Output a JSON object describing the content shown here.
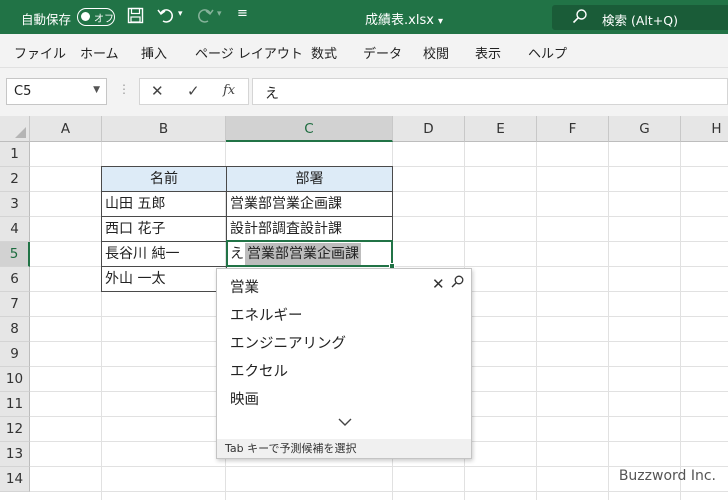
{
  "titlebar": {
    "autosave_label": "自動保存",
    "autosave_toggle": "オフ",
    "filename": "成績表.xlsx",
    "search_placeholder": "検索 (Alt+Q)"
  },
  "ribbon": {
    "tabs": [
      "ファイル",
      "ホーム",
      "挿入",
      "ページ レイアウト",
      "数式",
      "データ",
      "校閲",
      "表示",
      "ヘルプ"
    ]
  },
  "formula_bar": {
    "name_box": "C5",
    "fx_label": "fx",
    "value": "え"
  },
  "grid": {
    "columns": [
      "A",
      "B",
      "C",
      "D",
      "E",
      "F",
      "G",
      "H"
    ],
    "rows": [
      "1",
      "2",
      "3",
      "4",
      "5",
      "6",
      "7",
      "8",
      "9",
      "10",
      "11",
      "12",
      "13",
      "14"
    ],
    "selected_column": "C",
    "selected_row": "5"
  },
  "table": {
    "header": [
      "名前",
      "部署"
    ],
    "rows": [
      [
        "山田 五郎",
        "営業部営業企画課"
      ],
      [
        "西口 花子",
        "設計部調査設計課"
      ],
      [
        "長谷川 純一",
        ""
      ],
      [
        "外山 一太",
        ""
      ]
    ]
  },
  "active_cell": {
    "typed": "え",
    "suggestion": "営業部営業企画課"
  },
  "autocomplete": {
    "items": [
      "営業",
      "エネルギー",
      "エンジニアリング",
      "エクセル",
      "映画"
    ],
    "footer": "Tab キーで予測候補を選択"
  },
  "watermark": "Buzzword Inc.",
  "colors": {
    "excel_green": "#217346",
    "header_fill": "#ddebf7"
  }
}
